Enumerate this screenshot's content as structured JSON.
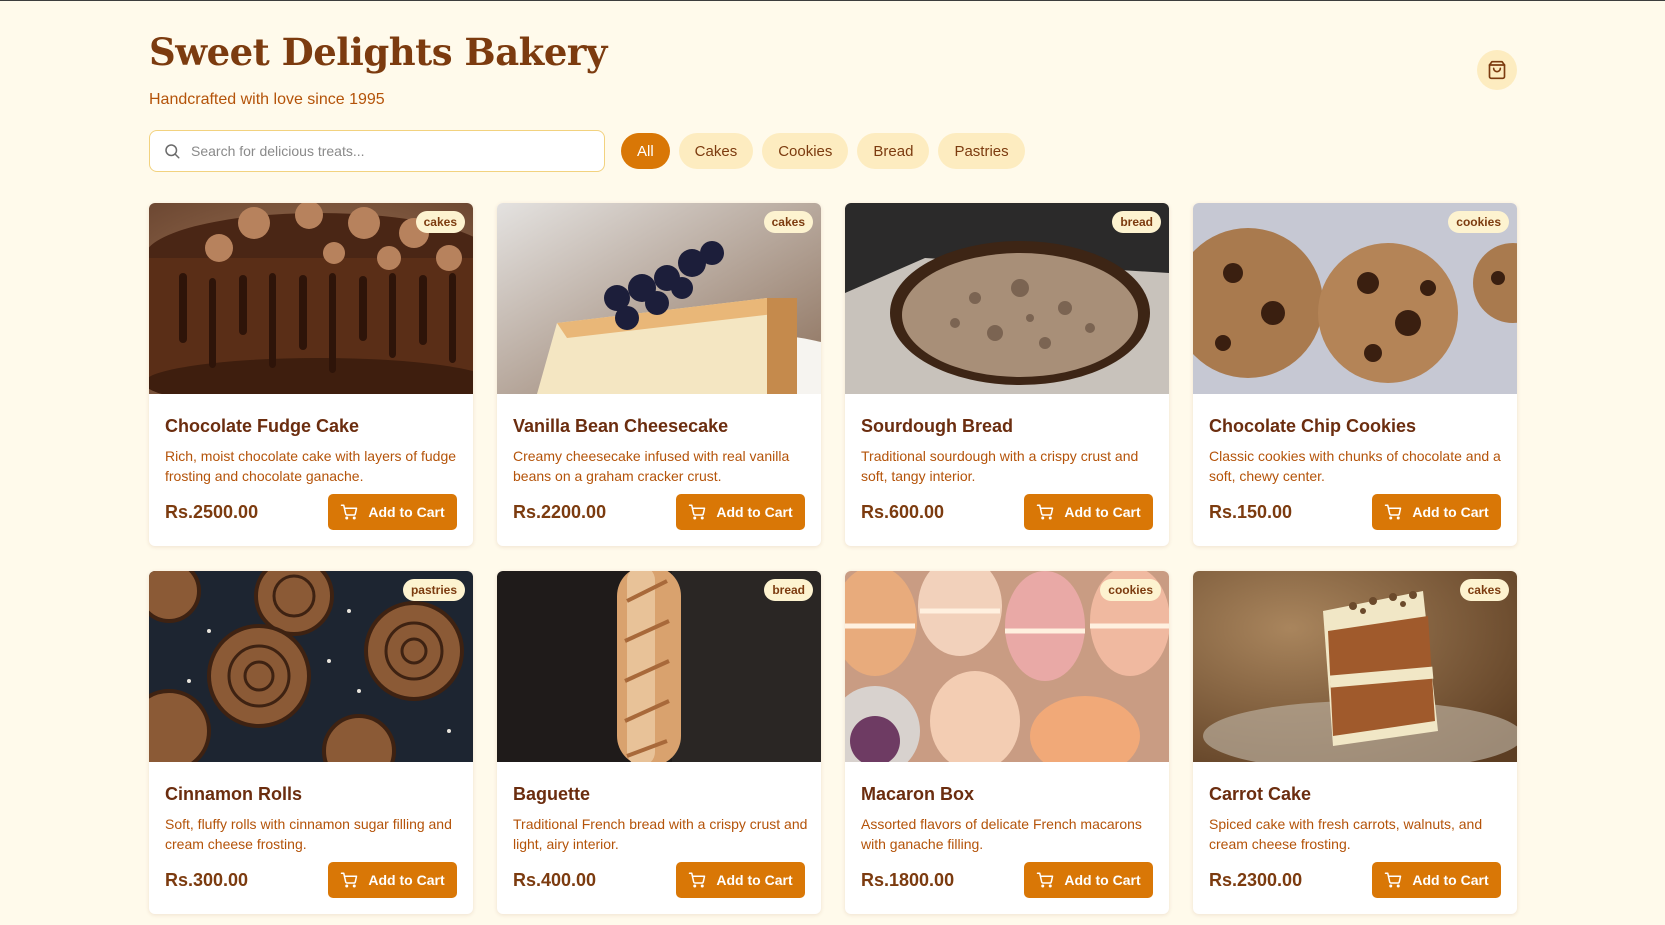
{
  "header": {
    "title": "Sweet Delights Bakery",
    "subtitle": "Handcrafted with love since 1995",
    "cart_icon": "shopping-bag-icon"
  },
  "search": {
    "placeholder": "Search for delicious treats...",
    "value": "",
    "icon": "search-icon"
  },
  "filters": [
    {
      "label": "All",
      "active": true
    },
    {
      "label": "Cakes",
      "active": false
    },
    {
      "label": "Cookies",
      "active": false
    },
    {
      "label": "Bread",
      "active": false
    },
    {
      "label": "Pastries",
      "active": false
    }
  ],
  "colors": {
    "background": "#fffaeb",
    "accent": "#d97706",
    "heading": "#7c3b0f",
    "body_text": "#b45309",
    "pill": "#fdecc0"
  },
  "add_to_cart_label": "Add to Cart",
  "products": [
    {
      "name": "Chocolate Fudge Cake",
      "description": "Rich, moist chocolate cake with layers of fudge frosting and chocolate ganache.",
      "price": "Rs.2500.00",
      "category": "cakes",
      "image": "chocolate-cake-photo"
    },
    {
      "name": "Vanilla Bean Cheesecake",
      "description": "Creamy cheesecake infused with real vanilla beans on a graham cracker crust.",
      "price": "Rs.2200.00",
      "category": "cakes",
      "image": "cheesecake-photo"
    },
    {
      "name": "Sourdough Bread",
      "description": "Traditional sourdough with a crispy crust and soft, tangy interior.",
      "price": "Rs.600.00",
      "category": "bread",
      "image": "sourdough-photo"
    },
    {
      "name": "Chocolate Chip Cookies",
      "description": "Classic cookies with chunks of chocolate and a soft, chewy center.",
      "price": "Rs.150.00",
      "category": "cookies",
      "image": "cookies-photo"
    },
    {
      "name": "Cinnamon Rolls",
      "description": "Soft, fluffy rolls with cinnamon sugar filling and cream cheese frosting.",
      "price": "Rs.300.00",
      "category": "pastries",
      "image": "cinnamon-rolls-photo"
    },
    {
      "name": "Baguette",
      "description": "Traditional French bread with a crispy crust and light, airy interior.",
      "price": "Rs.400.00",
      "category": "bread",
      "image": "baguette-photo"
    },
    {
      "name": "Macaron Box",
      "description": "Assorted flavors of delicate French macarons with ganache filling.",
      "price": "Rs.1800.00",
      "category": "cookies",
      "image": "macarons-photo"
    },
    {
      "name": "Carrot Cake",
      "description": "Spiced cake with fresh carrots, walnuts, and cream cheese frosting.",
      "price": "Rs.2300.00",
      "category": "cakes",
      "image": "carrot-cake-photo"
    }
  ]
}
